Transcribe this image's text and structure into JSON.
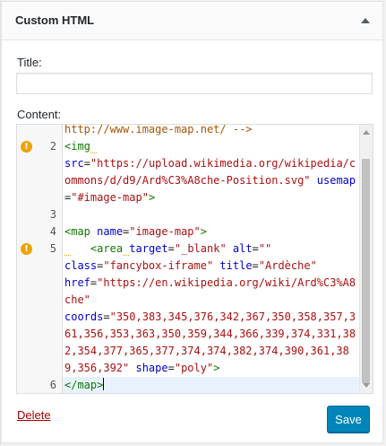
{
  "widget": {
    "title": "Custom HTML",
    "toggle_icon": "arrow-up-icon"
  },
  "form": {
    "title_label": "Title:",
    "title_value": "",
    "content_label": "Content:"
  },
  "editor": {
    "lines": [
      {
        "number": "",
        "warning": false,
        "html": "<span class=\"t-com\">http://www.image-map.net/ --></span>"
      },
      {
        "number": "2",
        "warning": true,
        "html": "<span class=\"t-tag\">&lt;img</span><span class=\"t-warn\"> </span>\n<span class=\"t-attr\">src</span>=<span class=\"t-str\">\"https://upload.wikimedia.org/wikipedia/commons/d/d9/Ard%C3%A8che-Position.svg\"</span> <span class=\"t-attr\">usemap</span>=<span class=\"t-str\">\"#image-map\"</span><span class=\"t-tag\">&gt;</span>"
      },
      {
        "number": "3",
        "warning": false,
        "html": ""
      },
      {
        "number": "4",
        "warning": false,
        "html": "<span class=\"t-tag\">&lt;map</span> <span class=\"t-attr\">name</span>=<span class=\"t-str\">\"image-map\"</span><span class=\"t-tag\">&gt;</span>"
      },
      {
        "number": "5",
        "warning": true,
        "html": "<span class=\"t-warn\"> </span>   <span class=\"t-tag\">&lt;area</span><span class=\"t-warn\"> </span><span class=\"t-attr\">target</span>=<span class=\"t-str\">\"_blank\"</span> <span class=\"t-attr\">alt</span>=<span class=\"t-str\">\"\"</span>\n<span class=\"t-attr\">class</span>=<span class=\"t-str\">\"fancybox-iframe\"</span> <span class=\"t-attr\">title</span>=<span class=\"t-str\">\"Ardèche\"</span>\n<span class=\"t-attr\">href</span>=<span class=\"t-str\">\"https://en.wikipedia.org/wiki/Ard%C3%A8che\"</span>\n<span class=\"t-attr\">coords</span>=<span class=\"t-str\">\"350,383,345,376,342,367,350,358,357,361,356,353,363,350,359,344,366,339,374,331,382,354,377,365,377,374,374,382,374,390,361,389,356,392\"</span> <span class=\"t-attr\">shape</span>=<span class=\"t-str\">\"poly\"</span><span class=\"t-tag\">&gt;</span>"
      },
      {
        "number": "6",
        "warning": false,
        "active": true,
        "html": "<span class=\"t-tag\">&lt;/map&gt;</span>"
      }
    ],
    "warning_symbol": "!"
  },
  "footer": {
    "delete_label": "Delete",
    "save_label": "Save"
  },
  "colors": {
    "primary_button": "#0085ba",
    "delete_link": "#a00",
    "warning": "#f0a200"
  }
}
